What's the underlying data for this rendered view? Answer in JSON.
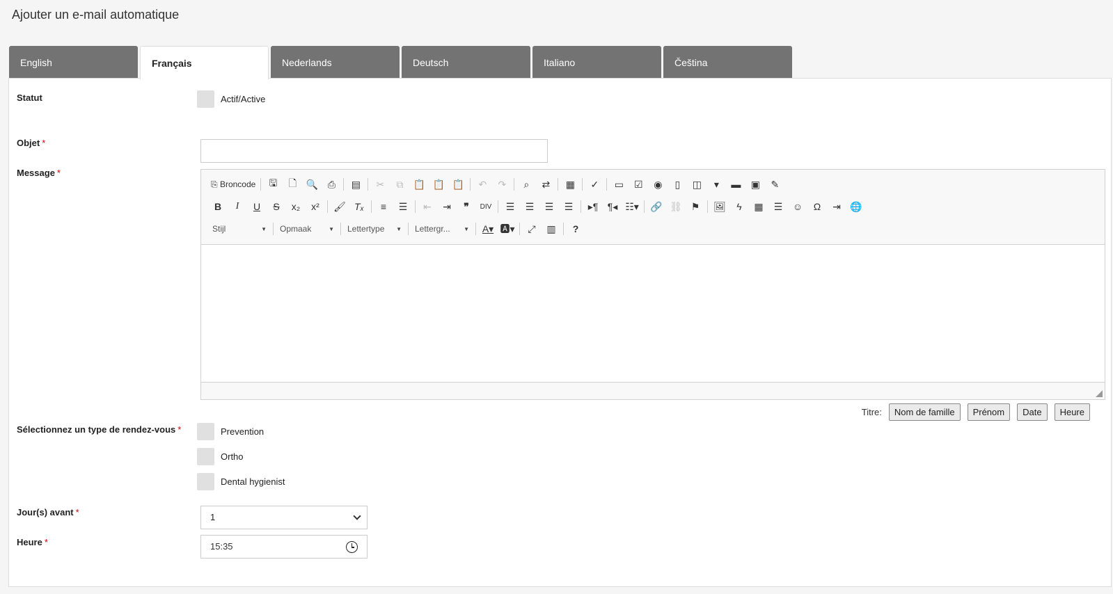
{
  "page": {
    "title": "Ajouter un e-mail automatique"
  },
  "tabs": [
    {
      "label": "English"
    },
    {
      "label": "Français"
    },
    {
      "label": "Nederlands"
    },
    {
      "label": "Deutsch"
    },
    {
      "label": "Italiano"
    },
    {
      "label": "Čeština"
    }
  ],
  "active_tab": "Français",
  "form": {
    "status": {
      "label": "Statut",
      "option": "Actif/Active"
    },
    "subject": {
      "label": "Objet",
      "required": "*",
      "value": ""
    },
    "message": {
      "label": "Message",
      "required": "*"
    },
    "appointment_type": {
      "label": "Sélectionnez un type de rendez-vous",
      "required": "*",
      "options": [
        {
          "label": "Prevention"
        },
        {
          "label": "Ortho"
        },
        {
          "label": "Dental hygienist"
        }
      ]
    },
    "days_before": {
      "label": "Jour(s) avant",
      "required": "*",
      "value": "1"
    },
    "time": {
      "label": "Heure",
      "required": "*",
      "value": "15:35"
    }
  },
  "editor": {
    "source_label": "Broncode",
    "combos": {
      "style": "Stijl",
      "format": "Opmaak",
      "font": "Lettertype",
      "size": "Lettergr..."
    }
  },
  "inserts": {
    "title": "Titre:",
    "buttons": [
      "Nom de famille",
      "Prénom",
      "Date",
      "Heure"
    ]
  }
}
